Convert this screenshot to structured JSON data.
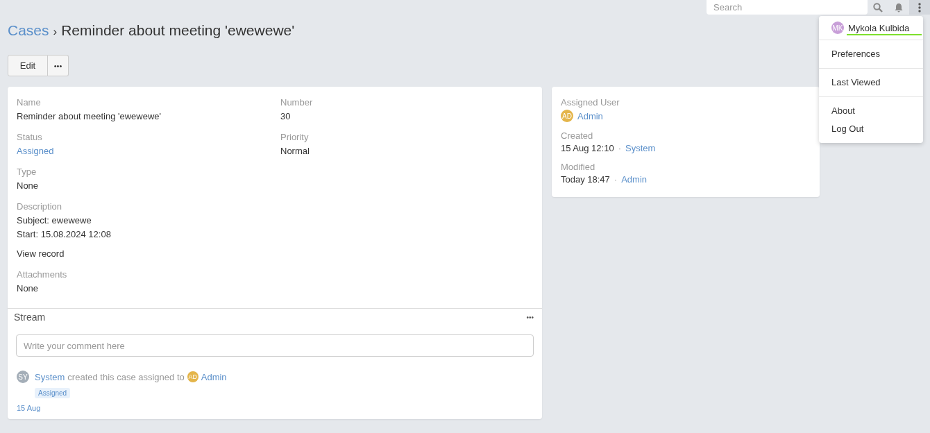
{
  "header": {
    "search": {
      "placeholder": "Search"
    },
    "menu_open": true
  },
  "breadcrumb": {
    "parent": "Cases",
    "separator": "›",
    "title": "Reminder about meeting 'ewewewe'"
  },
  "actions": [
    {
      "label": "Edit",
      "kind": "text"
    },
    {
      "label": "•••",
      "kind": "more"
    }
  ],
  "details": {
    "rows": [
      [
        {
          "label": "Name",
          "kind": "text",
          "value": "Reminder about meeting 'ewewewe'"
        },
        {
          "label": "Number",
          "kind": "text",
          "value": "30"
        }
      ],
      [
        {
          "label": "Status",
          "kind": "link",
          "value": "Assigned"
        },
        {
          "label": "Priority",
          "kind": "text",
          "value": "Normal"
        }
      ],
      [
        {
          "label": "Type",
          "kind": "text",
          "value": "None"
        }
      ],
      [
        {
          "label": "Description",
          "kind": "lines",
          "lines": [
            "Subject: ewewewe",
            "Start: 15.08.2024 12:08"
          ],
          "link": "View record"
        }
      ],
      [
        {
          "label": "Attachments",
          "kind": "text",
          "value": "None"
        }
      ]
    ]
  },
  "stream": {
    "title": "Stream",
    "menu": "•••",
    "comment": {
      "placeholder": "Write your comment here"
    },
    "entries": [
      {
        "avatar": {
          "initials": "SY",
          "color": "#a4aeb8"
        },
        "actor": "System",
        "text": "created this case assigned to",
        "target_avatar": {
          "initials": "AD",
          "color": "#e4b54a"
        },
        "target": "Admin",
        "tag": "Assigned",
        "date": "15 Aug"
      }
    ]
  },
  "side": {
    "fields": [
      {
        "label": "Assigned User",
        "kind": "user",
        "avatar": {
          "initials": "AD",
          "color": "#e4b54a"
        },
        "value": "Admin"
      },
      {
        "label": "Created",
        "kind": "date-user",
        "value": "15 Aug 12:10",
        "separator": "·",
        "user": "System"
      },
      {
        "label": "Modified",
        "kind": "date-user",
        "value": "Today 18:47",
        "separator": "·",
        "user": "Admin"
      }
    ]
  },
  "user_menu": {
    "avatar": {
      "initials": "MK",
      "color": "#c89fd8"
    },
    "name": "Mykola Kulbida",
    "groups": [
      [
        "Preferences"
      ],
      [
        "Last Viewed"
      ],
      [
        "About",
        "Log Out"
      ]
    ]
  }
}
